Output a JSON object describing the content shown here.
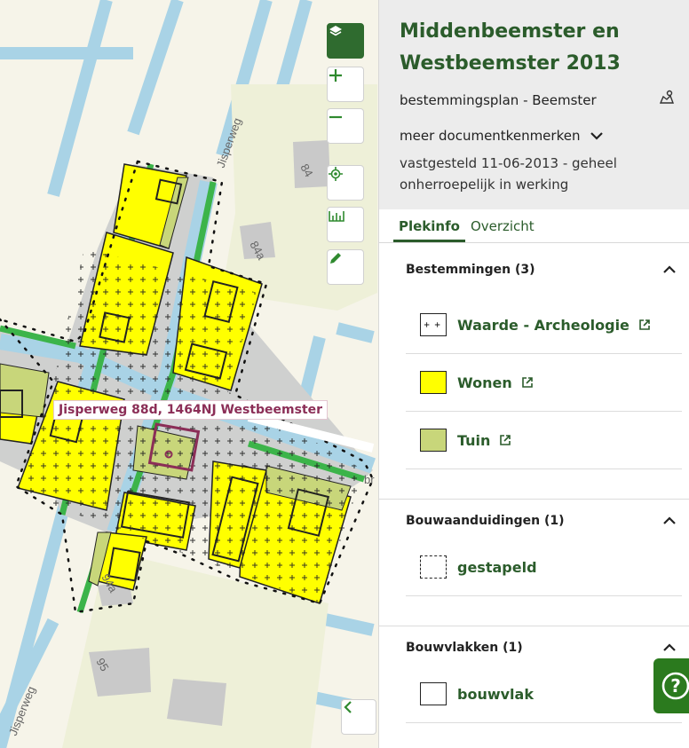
{
  "map": {
    "address_label": "Jisperweg 88d, 1464NJ Westbeemster",
    "street_labels": [
      "Jisperweg",
      "Jisperweg"
    ],
    "house_numbers": [
      "84",
      "84a",
      "94a",
      "95"
    ],
    "road_edge_label": "br",
    "colors": {
      "wonen": "#ffff00",
      "tuin": "#c8d67a",
      "verkeer": "#cfd0cf",
      "groen": "#3cb44a",
      "water": "#a9d3e6",
      "background": "#f6f4e9"
    },
    "controls": {
      "layers": "layers-icon",
      "zoom_in": "plus-icon",
      "zoom_out": "minus-icon",
      "locate": "locate-icon",
      "measure": "ruler-icon",
      "draw": "pencil-icon",
      "collapse": "chevron-left-icon"
    }
  },
  "panel": {
    "title_line1": "Middenbeemster en",
    "title_line2": "Westbeemster 2013",
    "subtitle": "bestemmingsplan - Beemster",
    "more_label": "meer documentkenmerken",
    "status_line1": "vastgesteld 11-06-2013 - geheel",
    "status_line2": "onherroepelijk in werking",
    "tabs": [
      {
        "label": "Plekinfo",
        "active": true
      },
      {
        "label": "Overzicht",
        "active": false
      }
    ],
    "sections": [
      {
        "title": "Bestemmingen (3)",
        "items": [
          {
            "label": "Waarde - Archeologie",
            "swatch": "cross",
            "external": true
          },
          {
            "label": "Wonen",
            "swatch": "#ffff00",
            "external": true
          },
          {
            "label": "Tuin",
            "swatch": "#c8d67a",
            "external": true
          }
        ]
      },
      {
        "title": "Bouwaanduidingen (1)",
        "items": [
          {
            "label": "gestapeld",
            "swatch": "dashed",
            "external": false
          }
        ]
      },
      {
        "title": "Bouwvlakken (1)",
        "items": [
          {
            "label": "bouwvlak",
            "swatch": "outline",
            "external": false
          }
        ]
      }
    ],
    "help_label": "?"
  }
}
